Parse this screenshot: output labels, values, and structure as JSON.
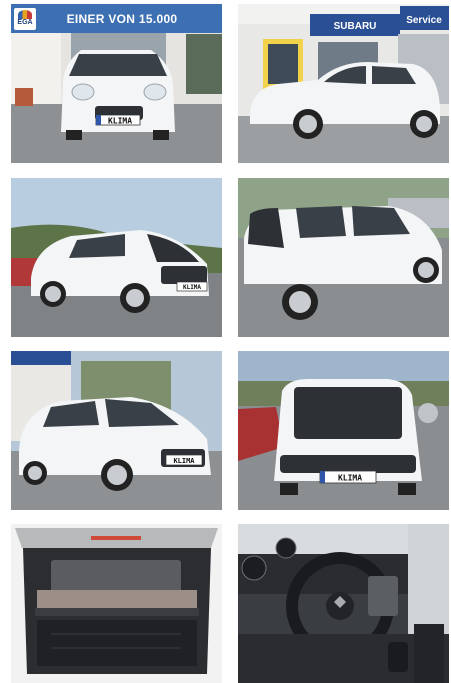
{
  "banner": {
    "logo_text": "EGA",
    "headline": "EINER VON 15.000"
  },
  "photos": [
    {
      "name": "front-view",
      "plate": "KLIMA"
    },
    {
      "name": "dealer-side-view",
      "sign_brand": "SUBARU",
      "sign_service": "Service",
      "plate": ""
    },
    {
      "name": "rear-three-quarter-view",
      "plate": "KLIMA"
    },
    {
      "name": "side-rear-view",
      "plate": ""
    },
    {
      "name": "front-three-quarter-view",
      "plate": "KLIMA"
    },
    {
      "name": "rear-view",
      "plate": "KLIMA"
    },
    {
      "name": "trunk-view",
      "plate": ""
    },
    {
      "name": "interior-dashboard-view",
      "plate": ""
    }
  ],
  "colors": {
    "banner_bg": "#3d6fb3",
    "car_body": "#f4f5f6",
    "asphalt": "#8a8e91",
    "sky": "#b9cde0"
  }
}
